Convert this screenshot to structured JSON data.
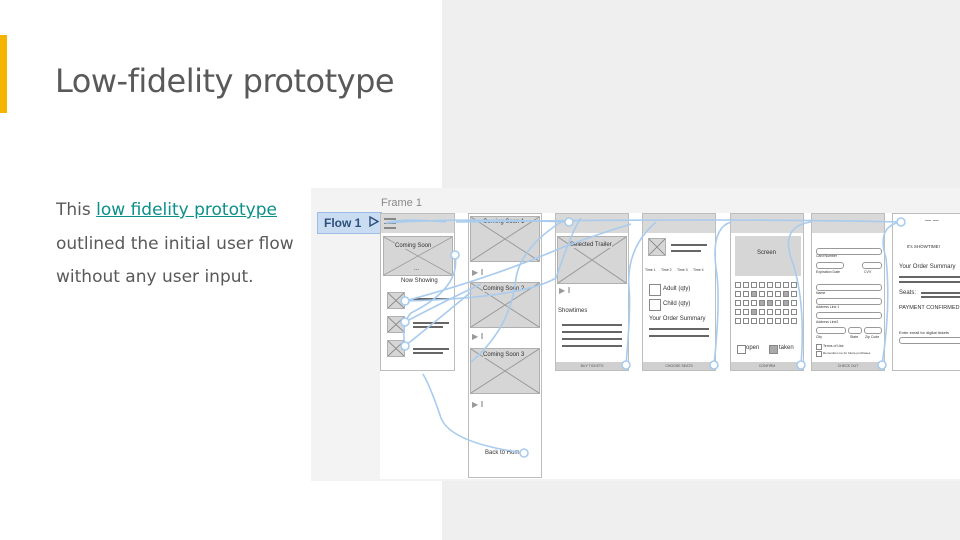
{
  "slide": {
    "title": "Low-fidelity prototype",
    "body_before": "This ",
    "body_link": "low fidelity prototype",
    "body_after": " outlined the initial user flow without any user input."
  },
  "prototype": {
    "frame_label": "Frame 1",
    "flow_label": "Flow 1",
    "screen_home": {
      "coming_soon": "Coming Soon",
      "dots": "...",
      "now_showing": "Now Showing"
    },
    "screen_coming": {
      "item1": "Coming Soon 1",
      "item2": "Coming Soon 2",
      "item3": "Coming Soon 3",
      "back": "Back to Home"
    },
    "screen_trailer": {
      "title": "Selected Trailer",
      "showtimes": "Showtimes",
      "button": "BUY TICKETS"
    },
    "screen_tickets": {
      "times": [
        "Time 1",
        "Time 2",
        "Time 3",
        "Time 4"
      ],
      "adult": "Adult (qty)",
      "child": "Child (qty)",
      "summary": "Your Order Summary",
      "button": "CHOOSE SEATS"
    },
    "screen_seats": {
      "screen": "Screen",
      "open": "open",
      "taken": "taken",
      "button": "CONFIRM"
    },
    "screen_checkout": {
      "card": "Card Number",
      "expiry": "Expiration Date",
      "cvv": "CVV",
      "name": "Name",
      "addr1": "Address Line 1",
      "addr2": "Address Line2",
      "city": "City",
      "state": "State",
      "zip": "Zip Code",
      "terms": "Terms of Use",
      "remember": "Remember me for future purchases",
      "button": "CHECK OUT"
    },
    "screen_confirm": {
      "showtime": "It's SHOWTIME!",
      "summary": "Your Order Summary",
      "seats": "Seats:",
      "payment": "PAYMENT CONFIRMED",
      "email": "Enter email for digital tickets"
    }
  }
}
